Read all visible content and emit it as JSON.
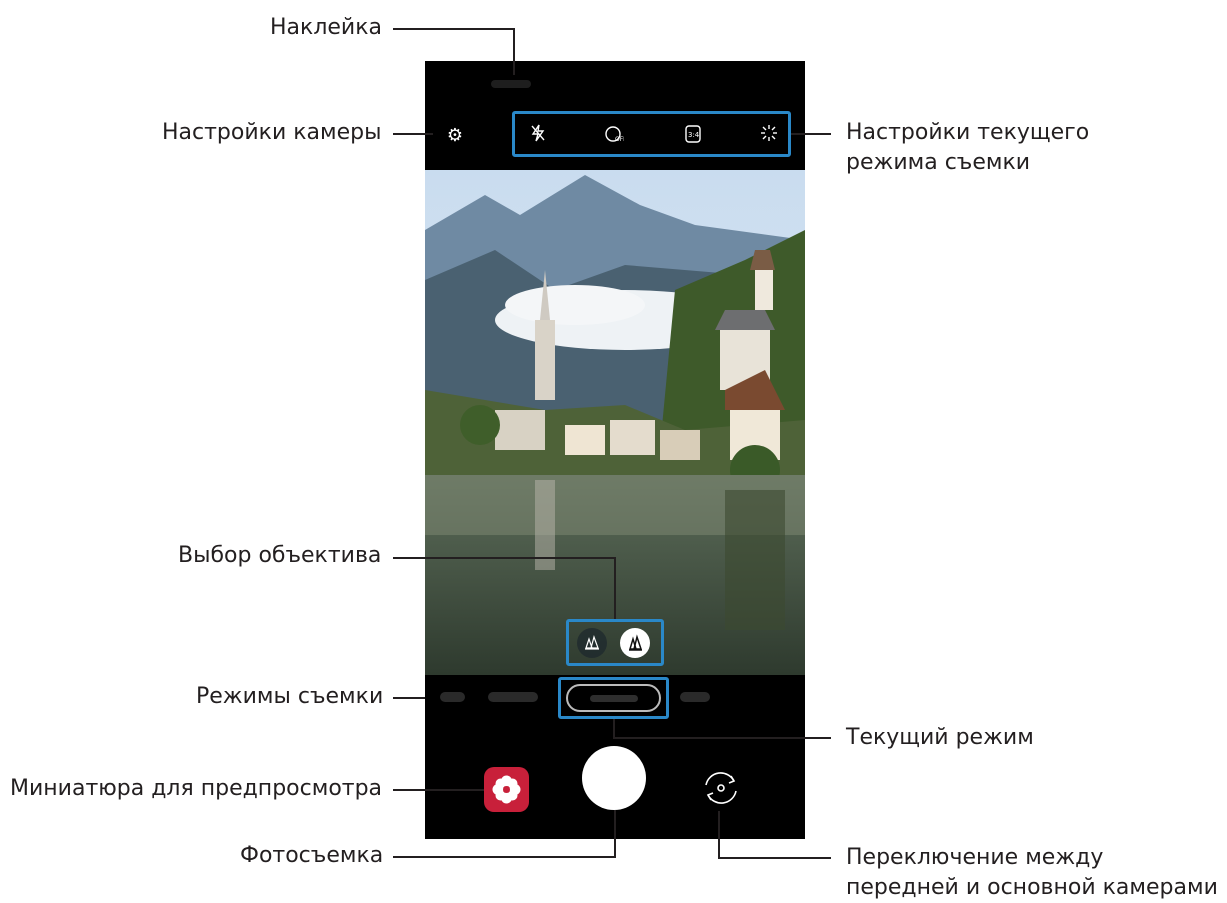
{
  "labels": {
    "sticker": "Наклейка",
    "camera_settings": "Настройки камеры",
    "mode_settings": "Настройки текущего режима съемки",
    "lens_select": "Выбор объектива",
    "shooting_modes": "Режимы съемки",
    "current_mode": "Текущий режим",
    "preview_thumbnail": "Миниатюра для предпросмотра",
    "take_photo": "Фотосъемка",
    "switch_camera": "Переключение между передней и основной камерами"
  },
  "icons": {
    "settings": "gear-icon",
    "flash": "flash-off-icon",
    "timer": "timer-off-icon",
    "ratio": "aspect-ratio-icon",
    "effects": "sparkle-icon",
    "lens_wide": "ultra-wide-lens-icon",
    "lens_main": "main-lens-icon",
    "gallery": "gallery-flower-icon",
    "switch": "switch-camera-icon"
  },
  "colors": {
    "highlight": "#2a88c8",
    "gallery_thumb": "#c8203a",
    "text": "#231f20"
  }
}
